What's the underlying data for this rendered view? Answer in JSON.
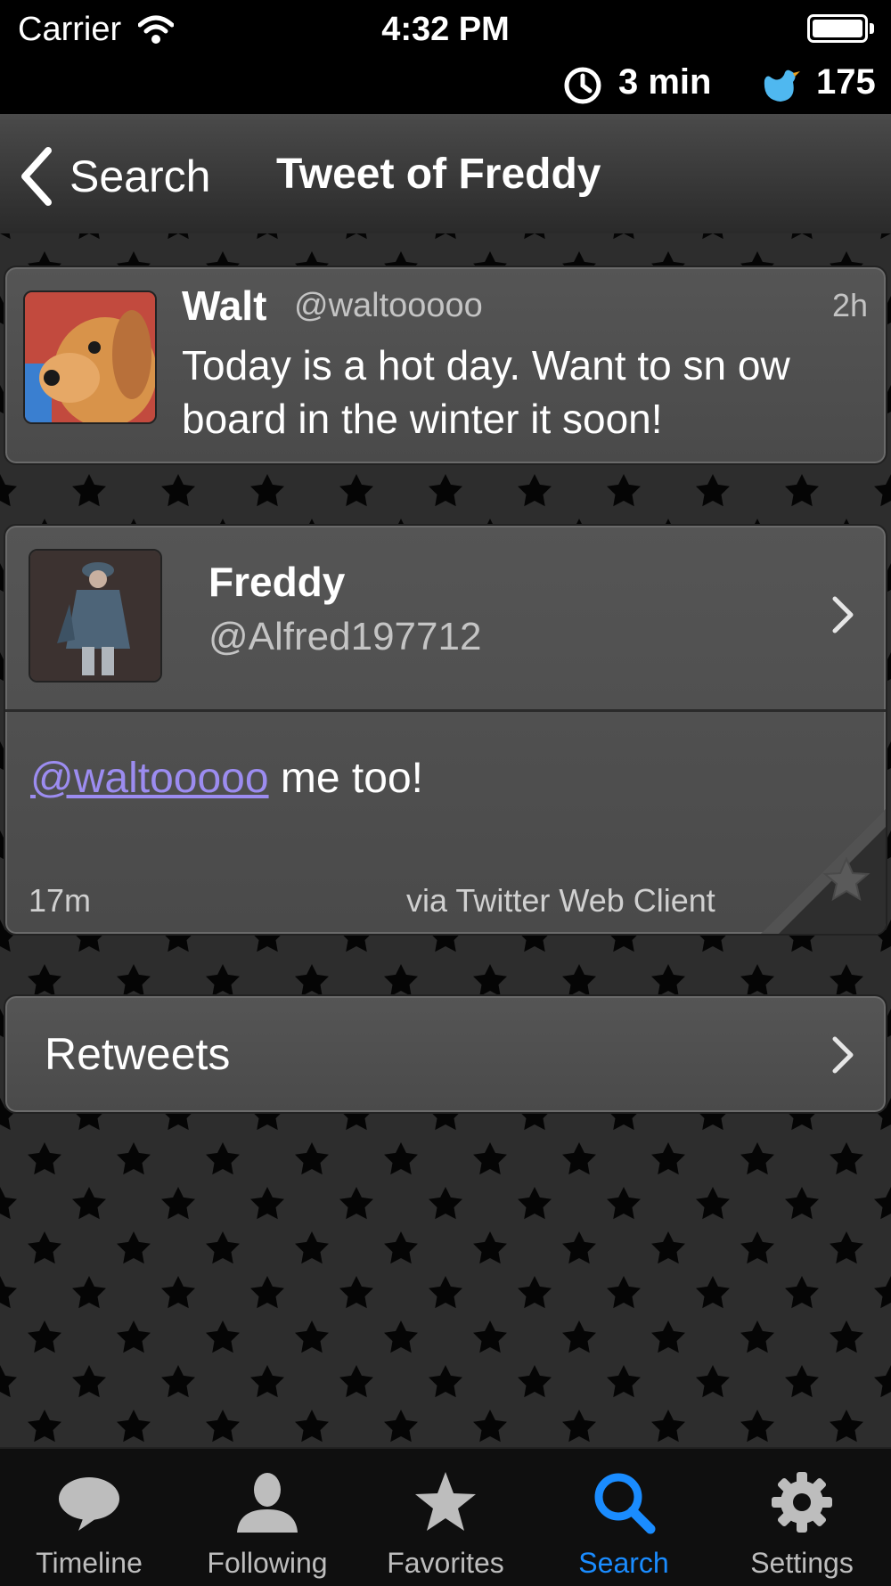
{
  "status_bar": {
    "carrier": "Carrier",
    "time": "4:32 PM",
    "interval": "3 min",
    "tweet_count": "175"
  },
  "nav": {
    "back_label": "Search",
    "title": "Tweet of Freddy"
  },
  "reply_tweet": {
    "name": "Walt",
    "handle": "@waltooooo",
    "time": "2h",
    "text": "Today is a hot day. Want to sn ow board in the winter it soon!"
  },
  "tweet": {
    "name": "Freddy",
    "handle": "@Alfred197712",
    "mention": "@waltooooo",
    "text": " me too!",
    "time": "17m",
    "via": "via Twitter Web Client"
  },
  "retweets": {
    "label": "Retweets"
  },
  "tabbar": {
    "items": [
      {
        "label": "Timeline",
        "icon": "speech-bubble-icon"
      },
      {
        "label": "Following",
        "icon": "person-icon"
      },
      {
        "label": "Favorites",
        "icon": "star-icon"
      },
      {
        "label": "Search",
        "icon": "magnifier-icon"
      },
      {
        "label": "Settings",
        "icon": "gear-icon"
      }
    ],
    "active_index": 3
  },
  "colors": {
    "accent": "#1a8cff",
    "mention": "#9c8cf0",
    "bird": "#4fb8f0"
  }
}
